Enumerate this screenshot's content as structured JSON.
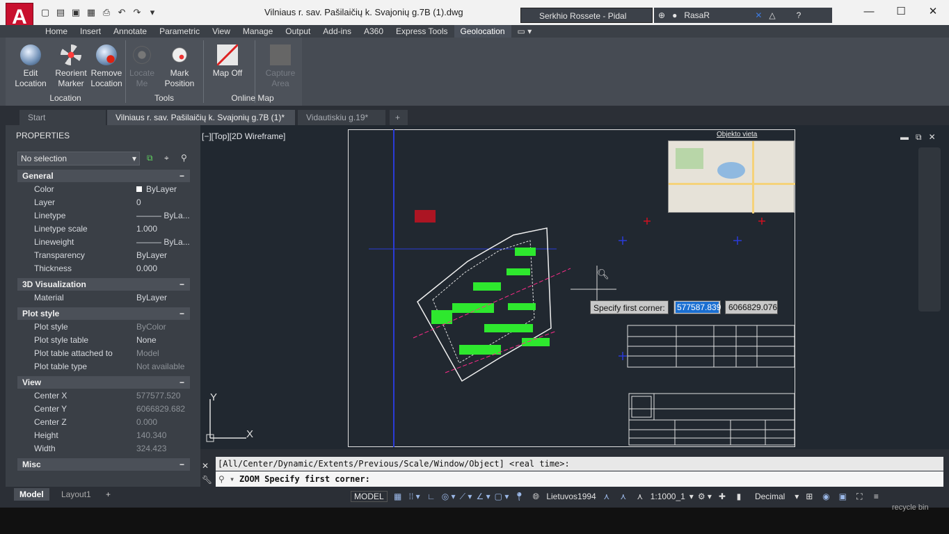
{
  "app": {
    "logo_letter": "A",
    "title": "Vilniaus r. sav. Pašilaičių k. Svajonių g.7B (1).dwg",
    "search_text": "Serkhio  Rossete - Pidal",
    "user": "RasaR",
    "help": "?"
  },
  "ribbon_tabs": [
    "Home",
    "Insert",
    "Annotate",
    "Parametric",
    "View",
    "Manage",
    "Output",
    "Add-ins",
    "A360",
    "Express Tools",
    "Geolocation"
  ],
  "active_tab": "Geolocation",
  "ribbon": {
    "buttons": [
      {
        "label1": "Edit",
        "label2": "Location",
        "icon": "globe-icon"
      },
      {
        "label1": "Reorient",
        "label2": "Marker",
        "icon": "marker-icon"
      },
      {
        "label1": "Remove",
        "label2": "Location",
        "icon": "remove-globe-icon"
      },
      {
        "label1": "Locate",
        "label2": "Me",
        "icon": "locate-icon"
      },
      {
        "label1": "Mark",
        "label2": "Position",
        "icon": "mark-position-icon"
      },
      {
        "label1": "Map Off",
        "label2": "",
        "icon": "map-off-icon"
      },
      {
        "label1": "Capture",
        "label2": "Area",
        "icon": "capture-area-icon"
      }
    ],
    "panels": [
      "Location",
      "Tools",
      "Online Map"
    ]
  },
  "doc_tabs": [
    "Start",
    "Vilniaus r. sav. Pašilaičių k. Svajonių g.7B (1)*",
    "Vidautiskiu g.19*",
    "+"
  ],
  "properties": {
    "title": "PROPERTIES",
    "selection": "No selection",
    "general": {
      "title": "General",
      "rows": [
        [
          "Color",
          "ByLayer"
        ],
        [
          "Layer",
          "0"
        ],
        [
          "Linetype",
          "ByLa..."
        ],
        [
          "Linetype scale",
          "1.000"
        ],
        [
          "Lineweight",
          "ByLa..."
        ],
        [
          "Transparency",
          "ByLayer"
        ],
        [
          "Thickness",
          "0.000"
        ]
      ]
    },
    "viz": {
      "title": "3D Visualization",
      "rows": [
        [
          "Material",
          "ByLayer"
        ]
      ]
    },
    "plot": {
      "title": "Plot style",
      "rows": [
        [
          "Plot style",
          "ByColor"
        ],
        [
          "Plot style table",
          "None"
        ],
        [
          "Plot table attached to",
          "Model"
        ],
        [
          "Plot table type",
          "Not available"
        ]
      ]
    },
    "view": {
      "title": "View",
      "rows": [
        [
          "Center X",
          "577577.520"
        ],
        [
          "Center Y",
          "6066829.682"
        ],
        [
          "Center Z",
          "0.000"
        ],
        [
          "Height",
          "140.340"
        ],
        [
          "Width",
          "324.423"
        ]
      ]
    },
    "misc": {
      "title": "Misc",
      "toggle": "−"
    }
  },
  "viewport": {
    "label": "[−][Top][2D Wireframe]",
    "map_title": "Objekto vieta",
    "tooltip_label": "Specify first corner:",
    "tooltip_x": "577587.839",
    "tooltip_y": "6066829.076",
    "ucs_y": "Y",
    "ucs_x": "X"
  },
  "cmd": {
    "history": "[All/Center/Dynamic/Extents/Previous/Scale/Window/Object] <real time>:",
    "input": "ZOOM Specify first corner:"
  },
  "layout_tabs": [
    "Model",
    "Layout1",
    "+"
  ],
  "status": {
    "model": "MODEL",
    "coord_sys": "Lietuvos1994",
    "scale": "1:1000_1",
    "units": "Decimal"
  },
  "watermark": "recycle bin"
}
